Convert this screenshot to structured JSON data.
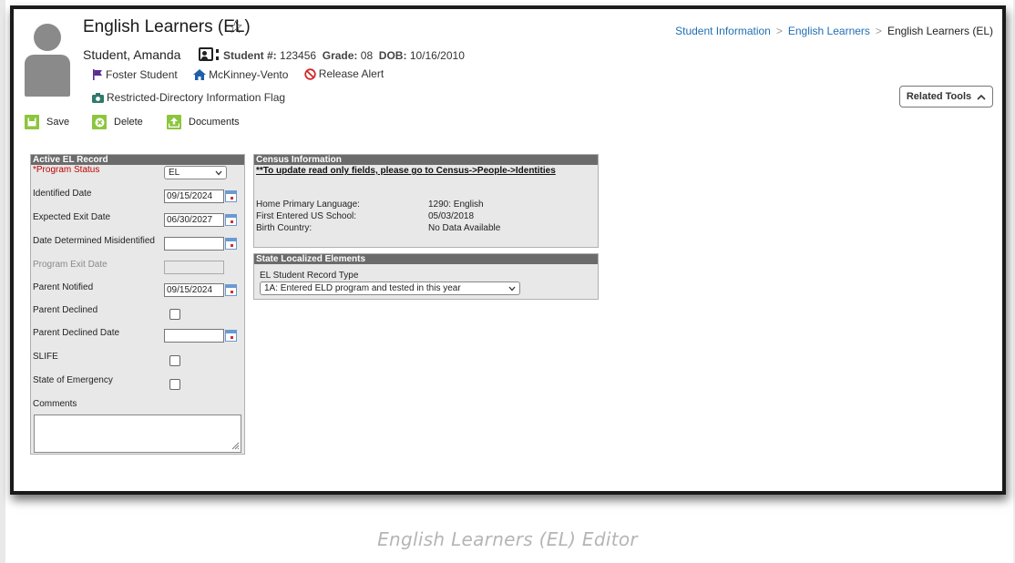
{
  "header": {
    "title": "English Learners (EL)",
    "student_name": "Student, Amanda",
    "student_num_label": "Student #:",
    "student_num": "123456",
    "grade_label": "Grade:",
    "grade": "08",
    "dob_label": "DOB:",
    "dob": "10/16/2010",
    "flags": [
      {
        "label": "Foster Student",
        "icon": "flag-icon",
        "color": "#5b2d8e"
      },
      {
        "label": "McKinney-Vento",
        "icon": "home-icon",
        "color": "#1f5fa8"
      },
      {
        "label": "Release Alert",
        "icon": "prohibited-icon",
        "color": "#d12a2a"
      }
    ],
    "restricted": "Restricted-Directory Information Flag"
  },
  "breadcrumb": {
    "items": [
      "Student Information",
      "English Learners"
    ],
    "current": "English Learners (EL)"
  },
  "related_tools": "Related Tools",
  "toolbar": {
    "save": "Save",
    "delete": "Delete",
    "documents": "Documents",
    "accent": "#8cc63e"
  },
  "el_record": {
    "header": "Active EL Record",
    "program_status_label": "*Program Status",
    "program_status_value": "EL",
    "identified_date_label": "Identified Date",
    "identified_date": "09/15/2024",
    "expected_exit_label": "Expected Exit Date",
    "expected_exit": "06/30/2027",
    "misidentified_label": "Date Determined Misidentified",
    "misidentified": "",
    "program_exit_label": "Program Exit Date",
    "program_exit": "",
    "parent_notified_label": "Parent Notified",
    "parent_notified": "09/15/2024",
    "parent_declined_label": "Parent Declined",
    "parent_declined_date_label": "Parent Declined Date",
    "parent_declined_date": "",
    "slife_label": "SLIFE",
    "state_emergency_label": "State of Emergency",
    "comments_label": "Comments",
    "comments": ""
  },
  "census": {
    "header": "Census Information",
    "note": "**To update read only fields, please go to Census->People->Identities",
    "rows": [
      {
        "label": "Home Primary Language:",
        "value": "1290: English"
      },
      {
        "label": "First Entered US School:",
        "value": "05/03/2018"
      },
      {
        "label": "Birth Country:",
        "value": "No Data Available"
      }
    ]
  },
  "state_elements": {
    "header": "State Localized Elements",
    "record_type_label": "EL Student Record Type",
    "record_type_value": "1A: Entered ELD program and tested in this year"
  },
  "caption": "English Learners (EL) Editor"
}
